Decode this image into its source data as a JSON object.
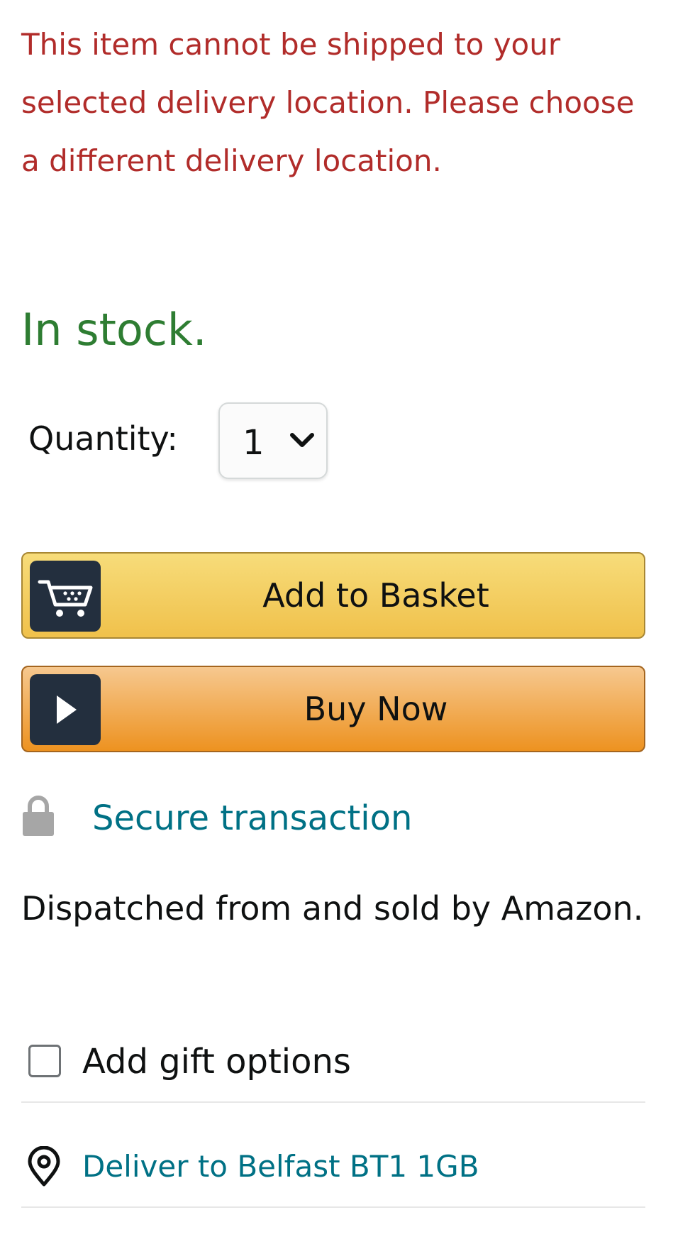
{
  "buy_box": {
    "shipping_warning": "This item cannot be shipped to your selected delivery location. Please choose a different delivery location.",
    "availability": "In stock.",
    "quantity": {
      "label": "Quantity:",
      "selected": "1"
    },
    "add_to_basket": {
      "label": "Add to Basket",
      "icon": "cart-icon"
    },
    "buy_now": {
      "label": "Buy Now",
      "icon": "play-icon"
    },
    "secure": {
      "label": "Secure transaction",
      "icon": "lock-icon"
    },
    "dispatch_text": "Dispatched from and sold by Amazon.",
    "gift_options": {
      "label": "Add gift options",
      "checked": false
    },
    "deliver_to": {
      "label": "Deliver to Belfast BT1 1GB",
      "icon": "location-pin-icon"
    }
  },
  "colors": {
    "warning": "#b12c2a",
    "in_stock": "#2e7d32",
    "link": "#007185",
    "add_to_basket_button": "#f0c14b",
    "buy_now_button": "#ed9220",
    "button_icon_background": "#232f3e"
  }
}
